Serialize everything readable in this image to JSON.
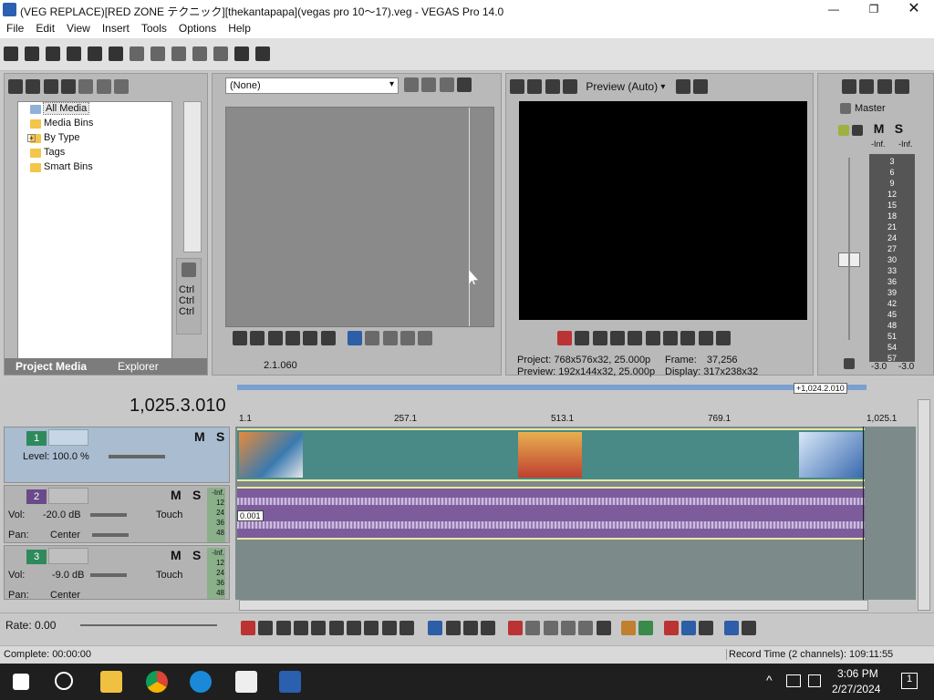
{
  "window": {
    "title": "(VEG REPLACE)[RED ZONE テクニック][thekantapapa](vegas pro 10〜17).veg - VEGAS Pro 14.0"
  },
  "menu": [
    "File",
    "Edit",
    "View",
    "Insert",
    "Tools",
    "Options",
    "Help"
  ],
  "media": {
    "tree": [
      "All Media",
      "Media Bins",
      "By Type",
      "Tags",
      "Smart Bins"
    ],
    "ctrl": [
      "Ctrl",
      "Ctrl",
      "Ctrl"
    ],
    "tabs": {
      "project": "Project Media",
      "explorer": "Explorer"
    }
  },
  "trimmer": {
    "dropdown": "(None)",
    "time": "2.1.060"
  },
  "preview": {
    "mode": "Preview (Auto)",
    "project_label": "Project:",
    "project_value": "768x576x32, 25.000p",
    "preview_label": "Preview:",
    "preview_value": "192x144x32, 25.000p",
    "frame_label": "Frame:",
    "frame_value": "37,256",
    "display_label": "Display:",
    "display_value": "317x238x32"
  },
  "mixer": {
    "master": "Master",
    "m": "M",
    "s": "S",
    "inf_l": "-Inf.",
    "inf_r": "-Inf.",
    "scale": [
      "3",
      "6",
      "9",
      "12",
      "15",
      "18",
      "21",
      "24",
      "27",
      "30",
      "33",
      "36",
      "39",
      "42",
      "45",
      "48",
      "51",
      "54",
      "57"
    ],
    "bottom_l": "-3.0",
    "bottom_r": "-3.0"
  },
  "timeline": {
    "time": "1,025.3.010",
    "range": "+1,024.2.010",
    "ruler": [
      "1.1",
      "257.1",
      "513.1",
      "769.1",
      "1,025.1"
    ],
    "marker": "0.001"
  },
  "tracks": {
    "t1": {
      "num": "1",
      "level": "Level: 100.0 %",
      "m": "M",
      "s": "S"
    },
    "t2": {
      "num": "2",
      "vol_label": "Vol:",
      "vol": "-20.0 dB",
      "pan_label": "Pan:",
      "pan": "Center",
      "touch": "Touch",
      "m": "M",
      "s": "S",
      "meter": [
        "-Inf.",
        "12",
        "24",
        "36",
        "48"
      ]
    },
    "t3": {
      "num": "3",
      "vol_label": "Vol:",
      "vol": "-9.0 dB",
      "pan_label": "Pan:",
      "pan": "Center",
      "touch": "Touch",
      "m": "M",
      "s": "S",
      "meter": [
        "-Inf.",
        "12",
        "24",
        "36",
        "48"
      ]
    }
  },
  "rate": "Rate: 0.00",
  "status": {
    "left": "Complete: 00:00:00",
    "right": "Record Time (2 channels): 109:11:55"
  },
  "taskbar": {
    "time": "3:06 PM",
    "date": "2/27/2024",
    "notif": "1"
  }
}
